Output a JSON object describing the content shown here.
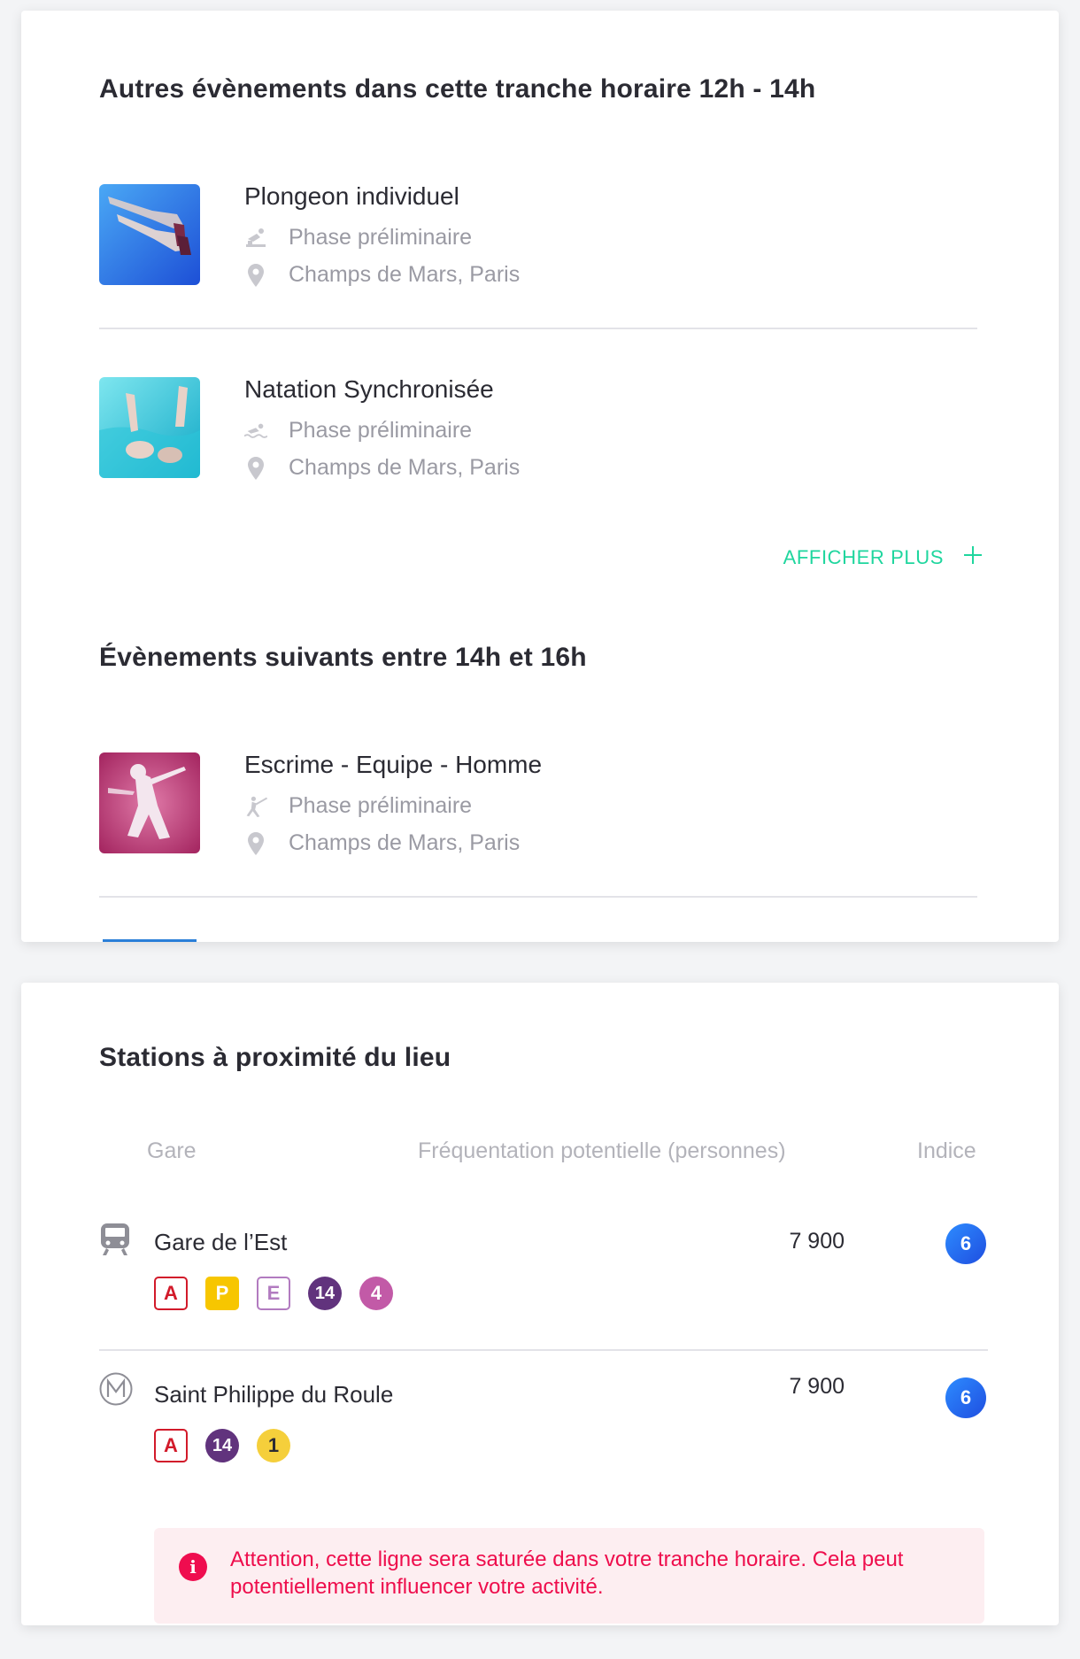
{
  "section1": {
    "title": "Autres évènements dans cette tranche horaire 12h - 14h",
    "events": [
      {
        "title": "Plongeon individuel",
        "phase": "Phase préliminaire",
        "location": "Champs de Mars, Paris",
        "sport_icon": "diving-icon"
      },
      {
        "title": "Natation Synchronisée",
        "phase": "Phase préliminaire",
        "location": "Champs de Mars, Paris",
        "sport_icon": "swimming-icon"
      }
    ],
    "show_more": "AFFICHER PLUS"
  },
  "section2": {
    "title": "Évènements suivants entre 14h et 16h",
    "events": [
      {
        "title": "Escrime - Equipe - Homme",
        "phase": "Phase préliminaire",
        "location": "Champs de Mars, Paris",
        "sport_icon": "fencing-icon"
      }
    ]
  },
  "stations": {
    "title": "Stations à proximité du lieu",
    "headers": {
      "station": "Gare",
      "attendance": "Fréquentation potentielle (personnes)",
      "index": "Indice"
    },
    "rows": [
      {
        "icon": "train-icon",
        "name": "Gare de l’Est",
        "attendance": "7 900",
        "index": "6",
        "lines": [
          "A",
          "P",
          "E",
          "14",
          "4"
        ]
      },
      {
        "icon": "metro-icon",
        "name": "Saint Philippe du Roule",
        "attendance": "7 900",
        "index": "6",
        "lines": [
          "A",
          "14",
          "1"
        ]
      }
    ],
    "alert": "Attention, cette ligne sera saturée dans votre tranche horaire. Cela peut potentiellement influencer votre activité."
  },
  "colors": {
    "accent_green": "#1fd69e",
    "index_blue": "#2563eb",
    "alert_red": "#ee0d4c",
    "alert_bg": "#fdeef1",
    "rer_a": "#d21a2a",
    "transilien_p": "#f7c600",
    "transilien_e": "#b27bc0",
    "metro_14": "#61337d",
    "metro_4": "#c25aa7",
    "metro_1": "#f5cf3b"
  }
}
